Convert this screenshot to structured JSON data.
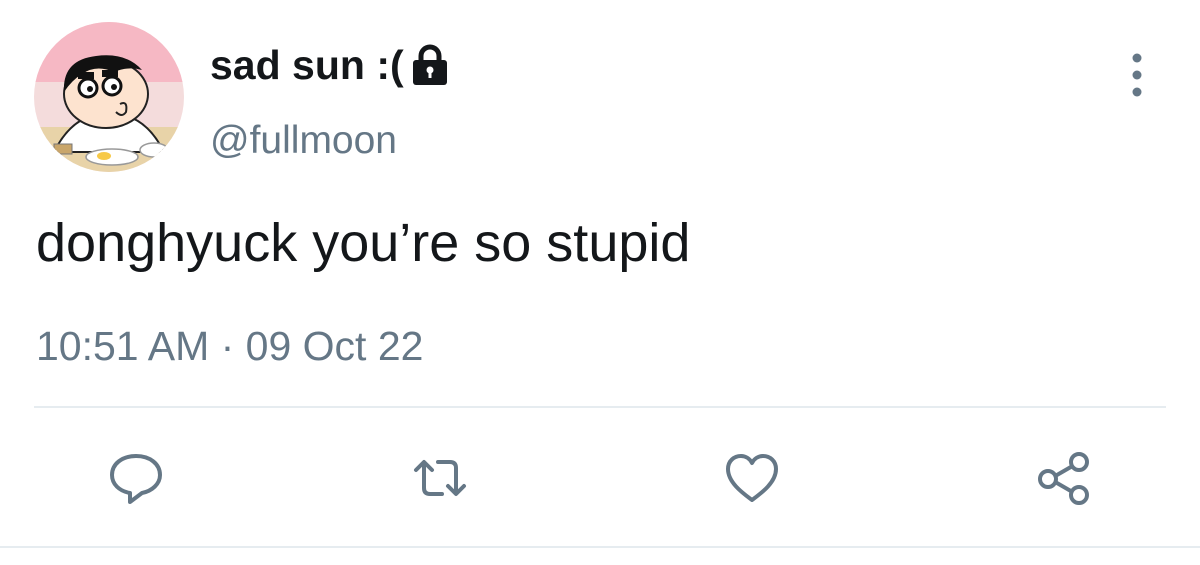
{
  "tweet": {
    "display_name": "sad sun :(",
    "handle": "@fullmoon",
    "text": "donghyuck you’re so stupid",
    "timestamp": "10:51 AM · 09 Oct 22",
    "protected": true
  },
  "icons": {
    "lock": "lock-icon",
    "more": "more-vertical-icon",
    "reply": "reply-icon",
    "retweet": "retweet-icon",
    "like": "heart-icon",
    "share": "share-icon"
  },
  "colors": {
    "text": "#14171a",
    "secondary": "#657786",
    "divider": "#e6ecf0"
  }
}
